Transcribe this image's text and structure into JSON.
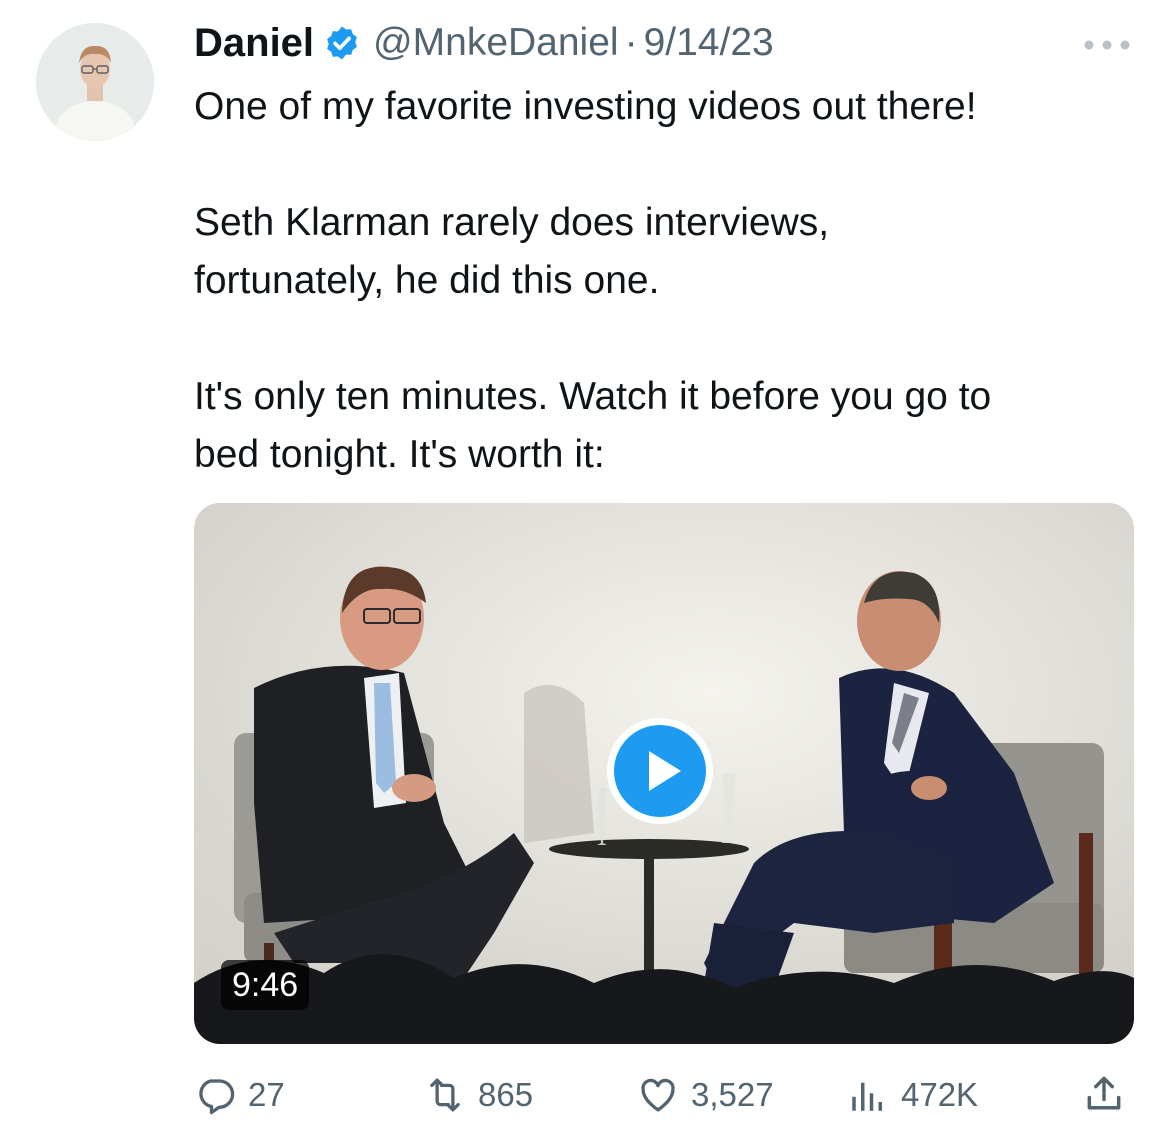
{
  "tweet": {
    "author": {
      "name": "Daniel",
      "verified_icon": "verified-badge-icon",
      "handle": "@MnkeDaniel",
      "separator": "·",
      "date": "9/14/23"
    },
    "more_icon": "more-horizontal-icon",
    "text": {
      "paragraph1": "One of my favorite investing videos out there!",
      "paragraph2_line1": "Seth Klarman rarely does interviews,",
      "paragraph2_line2": "fortunately, he did this one.",
      "paragraph3_line1": "It's only ten minutes. Watch it before you go to",
      "paragraph3_line2": "bed tonight. It's worth it:"
    },
    "media": {
      "type": "video",
      "duration": "9:46",
      "play_icon": "play-icon"
    },
    "actions": {
      "replies": "27",
      "retweets": "865",
      "likes": "3,527",
      "views": "472K",
      "share_icon": "share-icon"
    },
    "colors": {
      "accent": "#1d9bf0",
      "secondary_text": "#536471",
      "primary_text": "#0f1419"
    }
  }
}
